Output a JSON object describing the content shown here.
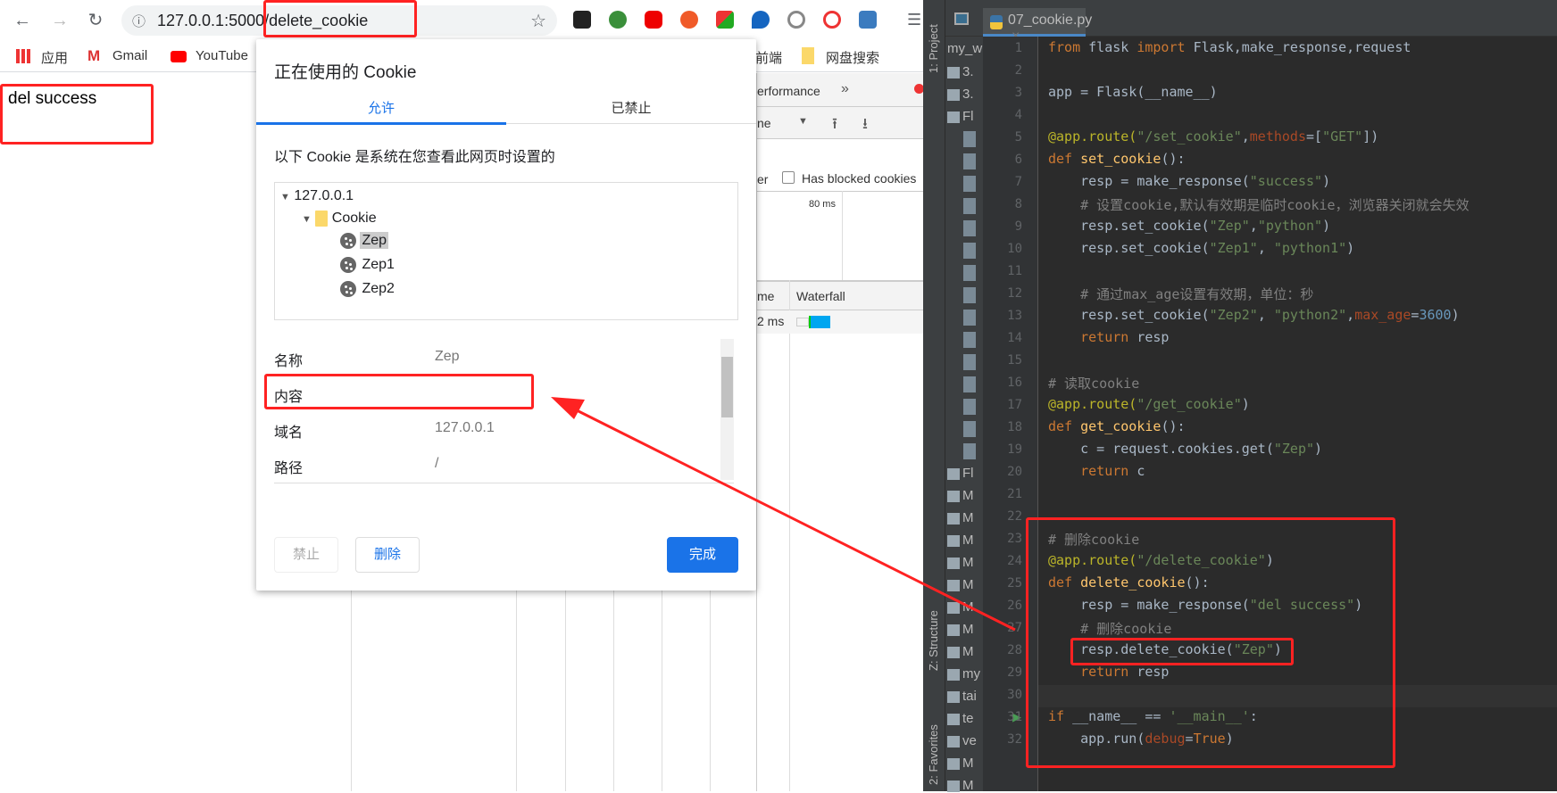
{
  "browser": {
    "url_host": "127.0.0.1",
    "url_path": ":5000/delete_cookie",
    "bookmarks": [
      "应用",
      "Gmail",
      "YouTube",
      "前端",
      "网盘搜索"
    ],
    "page_text": "del success"
  },
  "devtools": {
    "tab": "erformance",
    "more": "»",
    "throttle": "ne",
    "filter_suffix": "er",
    "blocked_label": "Has blocked cookies",
    "timeline_label": "80 ms",
    "col_time": "me",
    "col_waterfall": "Waterfall",
    "row_time": "2 ms"
  },
  "dialog": {
    "title": "正在使用的 Cookie",
    "tabs": [
      {
        "label": "允许",
        "active": true
      },
      {
        "label": "已禁止",
        "active": false
      }
    ],
    "description": "以下 Cookie 是系统在您查看此网页时设置的",
    "tree": {
      "host": "127.0.0.1",
      "folder": "Cookie",
      "cookies": [
        "Zep",
        "Zep1",
        "Zep2"
      ],
      "selected": "Zep"
    },
    "details": [
      {
        "label": "名称",
        "value": "Zep"
      },
      {
        "label": "内容",
        "value": ""
      },
      {
        "label": "域名",
        "value": "127.0.0.1"
      },
      {
        "label": "路径",
        "value": "/"
      }
    ],
    "buttons": {
      "block": "禁止",
      "remove": "删除",
      "done": "完成"
    }
  },
  "ide": {
    "file_tab": "07_cookie.py",
    "side_tabs": [
      "1: Project",
      "Z: Structure",
      "2: Favorites"
    ],
    "project_items": [
      "my_w",
      "3.",
      "3.",
      "Fl",
      "",
      "",
      "",
      "",
      "",
      "",
      "",
      "",
      "",
      "",
      "",
      "",
      "",
      "",
      "",
      "Fl",
      "M",
      "M",
      "M",
      "M",
      "M",
      "M",
      "M",
      "M",
      "my",
      "tai",
      "te",
      "ve",
      "M",
      "M"
    ],
    "code": [
      [
        [
          "from ",
          "kw"
        ],
        [
          "flask ",
          ""
        ],
        [
          "import ",
          "kw"
        ],
        [
          "Flask,make_response,request",
          ""
        ]
      ],
      [],
      [
        [
          "app = Flask(__name__)",
          ""
        ]
      ],
      [],
      [
        [
          "@app.route(",
          "dec"
        ],
        [
          "\"/set_cookie\"",
          "str"
        ],
        [
          ",",
          ""
        ],
        [
          "methods",
          "param"
        ],
        [
          "=[",
          ""
        ],
        [
          "\"GET\"",
          "str"
        ],
        [
          "])",
          ""
        ]
      ],
      [
        [
          "def ",
          "kw"
        ],
        [
          "set_cookie",
          "fn"
        ],
        [
          "():",
          ""
        ]
      ],
      [
        [
          "    resp = make_response(",
          ""
        ],
        [
          "\"success\"",
          "str"
        ],
        [
          ")",
          ""
        ]
      ],
      [
        [
          "    # 设置cookie,默认有效期是临时cookie，浏览器关闭就会失效",
          "cm"
        ]
      ],
      [
        [
          "    resp.set_cookie(",
          ""
        ],
        [
          "\"Zep\"",
          "str"
        ],
        [
          ",",
          ""
        ],
        [
          "\"python\"",
          "str"
        ],
        [
          ")",
          ""
        ]
      ],
      [
        [
          "    resp.set_cookie(",
          ""
        ],
        [
          "\"Zep1\"",
          "str"
        ],
        [
          ", ",
          ""
        ],
        [
          "\"python1\"",
          "str"
        ],
        [
          ")",
          ""
        ]
      ],
      [],
      [
        [
          "    # 通过max_age设置有效期，单位：秒",
          "cm"
        ]
      ],
      [
        [
          "    resp.set_cookie(",
          ""
        ],
        [
          "\"Zep2\"",
          "str"
        ],
        [
          ", ",
          ""
        ],
        [
          "\"python2\"",
          "str"
        ],
        [
          ",",
          ""
        ],
        [
          "max_age",
          "param"
        ],
        [
          "=",
          ""
        ],
        [
          "3600",
          "num"
        ],
        [
          ")",
          ""
        ]
      ],
      [
        [
          "    return ",
          "kw"
        ],
        [
          "resp",
          ""
        ]
      ],
      [],
      [
        [
          "# 读取cookie",
          "cm"
        ]
      ],
      [
        [
          "@app.route(",
          "dec"
        ],
        [
          "\"/get_cookie\"",
          "str"
        ],
        [
          ")",
          ""
        ]
      ],
      [
        [
          "def ",
          "kw"
        ],
        [
          "get_cookie",
          "fn"
        ],
        [
          "():",
          ""
        ]
      ],
      [
        [
          "    c = request.cookies.get(",
          ""
        ],
        [
          "\"Zep\"",
          "str"
        ],
        [
          ")",
          ""
        ]
      ],
      [
        [
          "    return ",
          "kw"
        ],
        [
          "c",
          ""
        ]
      ],
      [],
      [],
      [
        [
          "# 删除cookie",
          "cm"
        ]
      ],
      [
        [
          "@app.route(",
          "dec"
        ],
        [
          "\"/delete_cookie\"",
          "str"
        ],
        [
          ")",
          ""
        ]
      ],
      [
        [
          "def ",
          "kw"
        ],
        [
          "delete_cookie",
          "fn"
        ],
        [
          "():",
          ""
        ]
      ],
      [
        [
          "    resp = make_response(",
          ""
        ],
        [
          "\"del success\"",
          "str"
        ],
        [
          ")",
          ""
        ]
      ],
      [
        [
          "    # 删除cookie",
          "cm"
        ]
      ],
      [
        [
          "    resp.delete_cookie(",
          ""
        ],
        [
          "\"Zep\"",
          "str"
        ],
        [
          ")",
          ""
        ]
      ],
      [
        [
          "    return ",
          "kw"
        ],
        [
          "resp",
          ""
        ]
      ],
      [],
      [
        [
          "if ",
          "kw"
        ],
        [
          "__name__ == ",
          ""
        ],
        [
          "'__main__'",
          "str"
        ],
        [
          ":",
          ""
        ]
      ],
      [
        [
          "    app.run(",
          ""
        ],
        [
          "debug",
          "param"
        ],
        [
          "=",
          ""
        ],
        [
          "True",
          "kw"
        ],
        [
          ")",
          ""
        ]
      ]
    ]
  },
  "colors": {
    "annotation": "#ff2222",
    "accent": "#1a73e8"
  }
}
